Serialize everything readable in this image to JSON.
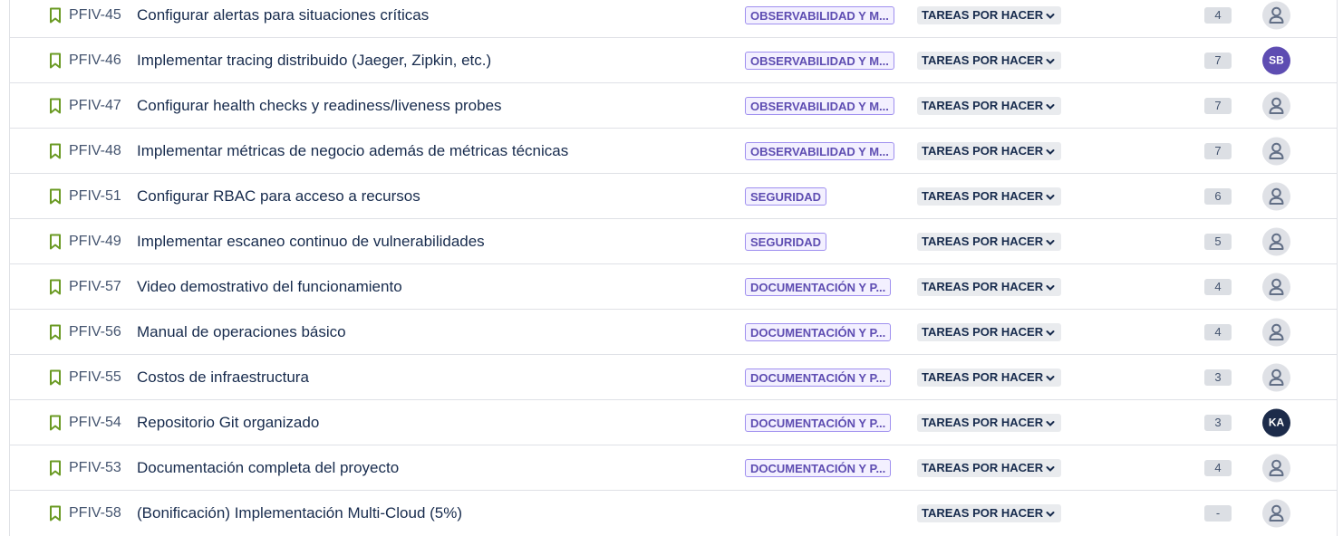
{
  "rows": [
    {
      "key": "PFIV-45",
      "summary": "Configurar alertas para situaciones críticas",
      "epic": "OBSERVABILIDAD Y M...",
      "status": "TAREAS POR HACER",
      "points": "4",
      "assignee": null
    },
    {
      "key": "PFIV-46",
      "summary": "Implementar tracing distribuido (Jaeger, Zipkin, etc.)",
      "epic": "OBSERVABILIDAD Y M...",
      "status": "TAREAS POR HACER",
      "points": "7",
      "assignee": {
        "initials": "SB",
        "color": "#5e4db2"
      }
    },
    {
      "key": "PFIV-47",
      "summary": "Configurar health checks y readiness/liveness probes",
      "epic": "OBSERVABILIDAD Y M...",
      "status": "TAREAS POR HACER",
      "points": "7",
      "assignee": null
    },
    {
      "key": "PFIV-48",
      "summary": "Implementar métricas de negocio además de métricas técnicas",
      "epic": "OBSERVABILIDAD Y M...",
      "status": "TAREAS POR HACER",
      "points": "7",
      "assignee": null
    },
    {
      "key": "PFIV-51",
      "summary": "Configurar RBAC para acceso a recursos",
      "epic": "SEGURIDAD",
      "status": "TAREAS POR HACER",
      "points": "6",
      "assignee": null
    },
    {
      "key": "PFIV-49",
      "summary": "Implementar escaneo continuo de vulnerabilidades",
      "epic": "SEGURIDAD",
      "status": "TAREAS POR HACER",
      "points": "5",
      "assignee": null
    },
    {
      "key": "PFIV-57",
      "summary": "Video demostrativo del funcionamiento",
      "epic": "DOCUMENTACIÓN Y P...",
      "status": "TAREAS POR HACER",
      "points": "4",
      "assignee": null
    },
    {
      "key": "PFIV-56",
      "summary": "Manual de operaciones básico",
      "epic": "DOCUMENTACIÓN Y P...",
      "status": "TAREAS POR HACER",
      "points": "4",
      "assignee": null
    },
    {
      "key": "PFIV-55",
      "summary": "Costos de infraestructura",
      "epic": "DOCUMENTACIÓN Y P...",
      "status": "TAREAS POR HACER",
      "points": "3",
      "assignee": null
    },
    {
      "key": "PFIV-54",
      "summary": "Repositorio Git organizado",
      "epic": "DOCUMENTACIÓN Y P...",
      "status": "TAREAS POR HACER",
      "points": "3",
      "assignee": {
        "initials": "KA",
        "color": "#1c2b4a"
      }
    },
    {
      "key": "PFIV-53",
      "summary": "Documentación completa del proyecto",
      "epic": "DOCUMENTACIÓN Y P...",
      "status": "TAREAS POR HACER",
      "points": "4",
      "assignee": null
    },
    {
      "key": "PFIV-58",
      "summary": "(Bonificación) Implementación Multi-Cloud (5%)",
      "epic": null,
      "status": "TAREAS POR HACER",
      "points": "-",
      "assignee": null
    }
  ],
  "colors": {
    "story_icon": "#6a9a23",
    "epic_bg": "#f3f0ff",
    "epic_border": "#9f8fef",
    "epic_text": "#5e4db2",
    "status_bg": "#e9ebee",
    "points_bg": "#dcdfe4",
    "empty_avatar_bg": "#dfe1e6",
    "empty_avatar_fg": "#626f86"
  }
}
